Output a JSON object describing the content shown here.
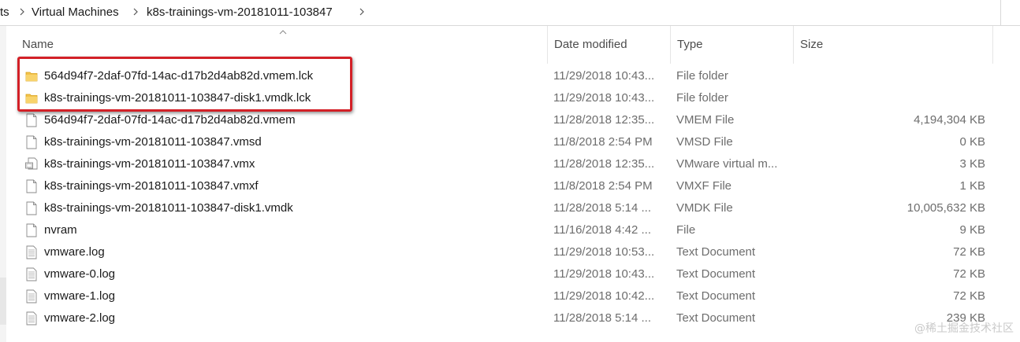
{
  "breadcrumb": {
    "items": [
      "ts",
      "Virtual Machines",
      "k8s-trainings-vm-20181011-103847"
    ]
  },
  "columns": {
    "name": "Name",
    "date": "Date modified",
    "type": "Type",
    "size": "Size"
  },
  "files": [
    {
      "icon": "folder-icon",
      "name": "564d94f7-2daf-07fd-14ac-d17b2d4ab82d.vmem.lck",
      "date": "11/29/2018 10:43...",
      "type": "File folder",
      "size": ""
    },
    {
      "icon": "folder-icon",
      "name": "k8s-trainings-vm-20181011-103847-disk1.vmdk.lck",
      "date": "11/29/2018 10:43...",
      "type": "File folder",
      "size": ""
    },
    {
      "icon": "file-icon",
      "name": "564d94f7-2daf-07fd-14ac-d17b2d4ab82d.vmem",
      "date": "11/28/2018 12:35...",
      "type": "VMEM File",
      "size": "4,194,304 KB"
    },
    {
      "icon": "file-icon",
      "name": "k8s-trainings-vm-20181011-103847.vmsd",
      "date": "11/8/2018 2:54 PM",
      "type": "VMSD File",
      "size": "0 KB"
    },
    {
      "icon": "vmx-icon",
      "name": "k8s-trainings-vm-20181011-103847.vmx",
      "date": "11/28/2018 12:35...",
      "type": "VMware virtual m...",
      "size": "3 KB"
    },
    {
      "icon": "file-icon",
      "name": "k8s-trainings-vm-20181011-103847.vmxf",
      "date": "11/8/2018 2:54 PM",
      "type": "VMXF File",
      "size": "1 KB"
    },
    {
      "icon": "file-icon",
      "name": "k8s-trainings-vm-20181011-103847-disk1.vmdk",
      "date": "11/28/2018 5:14 ...",
      "type": "VMDK File",
      "size": "10,005,632 KB"
    },
    {
      "icon": "file-icon",
      "name": "nvram",
      "date": "11/16/2018 4:42 ...",
      "type": "File",
      "size": "9 KB"
    },
    {
      "icon": "text-file-icon",
      "name": "vmware.log",
      "date": "11/29/2018 10:53...",
      "type": "Text Document",
      "size": "72 KB"
    },
    {
      "icon": "text-file-icon",
      "name": "vmware-0.log",
      "date": "11/29/2018 10:43...",
      "type": "Text Document",
      "size": "72 KB"
    },
    {
      "icon": "text-file-icon",
      "name": "vmware-1.log",
      "date": "11/29/2018 10:42...",
      "type": "Text Document",
      "size": "72 KB"
    },
    {
      "icon": "text-file-icon",
      "name": "vmware-2.log",
      "date": "11/28/2018 5:14 ...",
      "type": "Text Document",
      "size": "239 KB"
    }
  ],
  "watermark": "@稀土掘金技术社区",
  "colors": {
    "highlight": "#d32027",
    "folder": "#f3c24a"
  }
}
